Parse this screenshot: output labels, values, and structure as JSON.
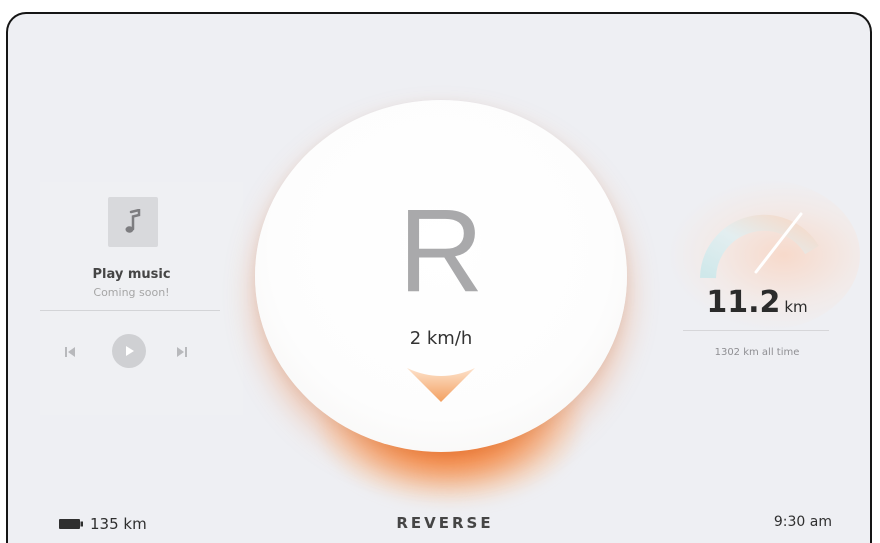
{
  "music": {
    "title": "Play music",
    "subtitle": "Coming soon!",
    "icons": {
      "note": "music-note-icon",
      "prev": "skip-previous-icon",
      "play": "play-icon",
      "next": "skip-next-icon"
    }
  },
  "drive": {
    "gear": "R",
    "speed": "2 km/h",
    "mode": "REVERSE"
  },
  "trip": {
    "value": "11.2",
    "unit": "km",
    "all_time": "1302 km all time"
  },
  "status": {
    "range": "135 km",
    "time": "9:30 am"
  },
  "colors": {
    "accent": "#f26a1b",
    "background": "#eeeff3"
  }
}
